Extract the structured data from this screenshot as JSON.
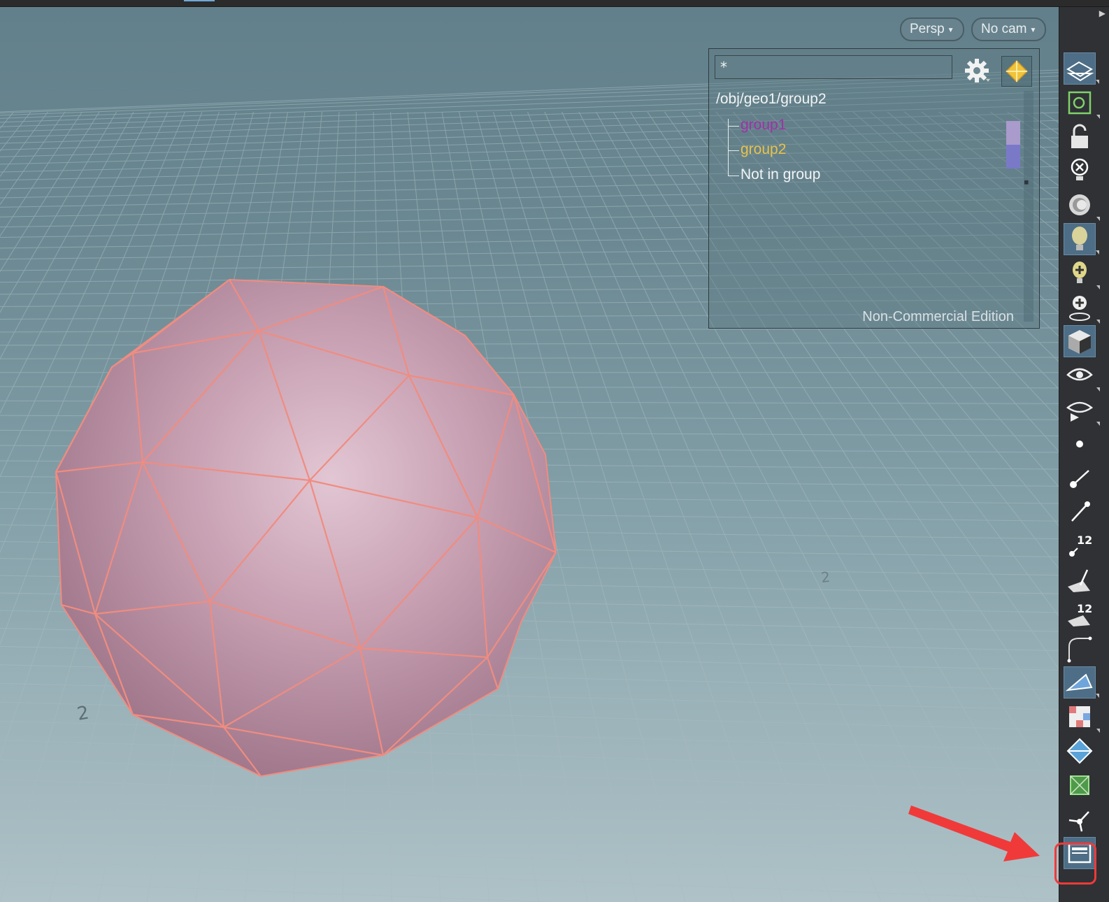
{
  "viewport": {
    "projection_label": "Persp",
    "camera_label": "No cam",
    "grid_numbers": [
      "2",
      "2"
    ]
  },
  "group_panel": {
    "filter_value": "*",
    "path": "/obj/geo1/group2",
    "items": [
      {
        "label": "group1",
        "text_color": "#a030a8",
        "swatch_color": "#a99bcc"
      },
      {
        "label": "group2",
        "text_color": "#e9c24a",
        "swatch_color": "#7a79c8"
      },
      {
        "label": "Not in group",
        "text_color": "#f2f4f5",
        "swatch_color": ""
      }
    ],
    "watermark": "Non-Commercial Edition"
  },
  "toolbar": {
    "tools": [
      {
        "icon": "display-options-icon"
      },
      {
        "icon": "snapping-icon"
      },
      {
        "icon": "lock-icon"
      },
      {
        "icon": "remove-light-icon"
      },
      {
        "icon": "ambient-occlusion-icon"
      },
      {
        "icon": "headlight-icon"
      },
      {
        "icon": "add-light-icon"
      },
      {
        "icon": "spot-light-icon"
      },
      {
        "icon": "shading-cube-icon"
      },
      {
        "icon": "visibility-eye-icon"
      },
      {
        "icon": "visibility-play-icon"
      },
      {
        "icon": "point-display-icon"
      },
      {
        "icon": "point-normal-icon"
      },
      {
        "icon": "vertex-normal-icon"
      },
      {
        "icon": "point-numbers-icon",
        "badge": "12"
      },
      {
        "icon": "primitive-normal-icon"
      },
      {
        "icon": "primitive-numbers-icon",
        "badge": "12"
      },
      {
        "icon": "profile-curve-icon"
      },
      {
        "icon": "primitive-hull-icon"
      },
      {
        "icon": "uv-texture-icon"
      },
      {
        "icon": "uv-diamond-icon"
      },
      {
        "icon": "uv-boundary-icon"
      },
      {
        "icon": "pivot-handle-icon"
      },
      {
        "icon": "group-list-icon"
      }
    ]
  },
  "colors": {
    "accent_highlight": "#f03a3a",
    "mesh_fill": "#c89aac",
    "mesh_edge": "#f08c80"
  }
}
